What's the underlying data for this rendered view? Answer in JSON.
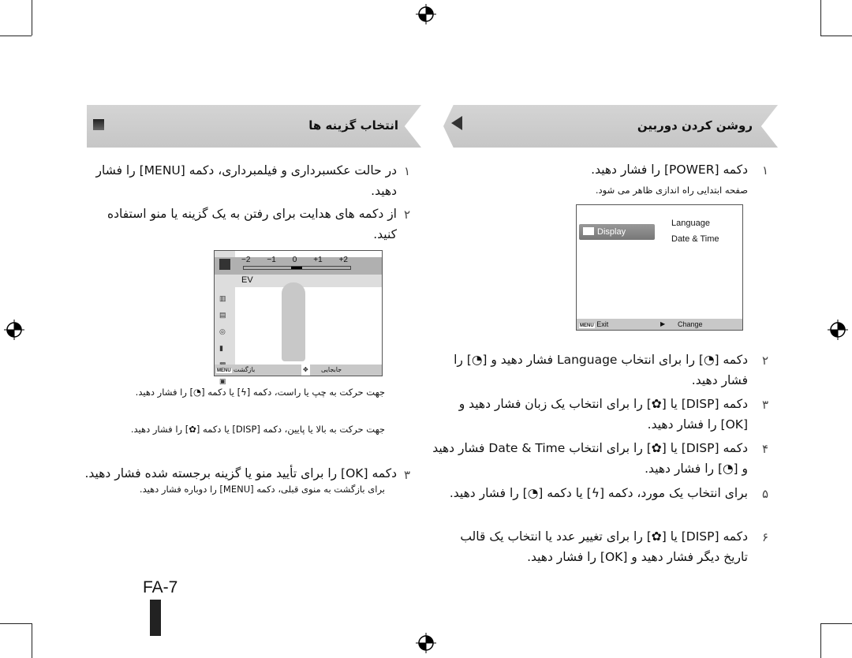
{
  "right": {
    "title": "روشن کردن دوربین",
    "steps": [
      {
        "num": "۱",
        "text": "دکمه [POWER] را فشار دهید.",
        "bullet": "صفحه ابتدایی راه اندازی ظاهر می شود."
      },
      {
        "num": "۲",
        "text": "دکمه [◔] را برای انتخاب Language فشار دهید و [◔] را فشار دهید."
      },
      {
        "num": "۳",
        "text": "دکمه [DISP] یا [✿] را برای انتخاب یک زبان فشار دهید و [OK] را فشار دهید."
      },
      {
        "num": "۴",
        "text": "دکمه [DISP] یا [✿] را برای انتخاب Date & Time فشار دهید و [◔] را فشار دهید."
      },
      {
        "num": "۵",
        "text": "برای انتخاب یک مورد، دکمه [ϟ] یا دکمه [◔] را فشار دهید."
      },
      {
        "num": "۶",
        "text": "دکمه [DISP] یا [✿] را برای تغییر عدد یا انتخاب یک قالب تاریخ دیگر فشار دهید و [OK] را فشار دهید."
      }
    ],
    "screen": {
      "menu_selected": "Display",
      "items": [
        "Language",
        "Date & Time"
      ],
      "exit_key": "MENU",
      "exit": "Exit",
      "change": "Change"
    }
  },
  "left": {
    "title": "انتخاب گزینه ها",
    "steps": [
      {
        "num": "۱",
        "text": "در حالت عکسبرداری و فیلمبرداری، دکمه [MENU] را فشار دهید."
      },
      {
        "num": "۲",
        "text": "از دکمه های هدایت برای رفتن به یک گزینه یا منو استفاده کنید.",
        "bullets": [
          "جهت حرکت به چپ یا راست، دکمه [ϟ] یا دکمه [◔] را فشار دهید.",
          "جهت حرکت به بالا یا پایین، دکمه [DISP] یا دکمه [✿] را فشار دهید."
        ]
      },
      {
        "num": "۳",
        "text": "دکمه [OK] را برای تأیید منو یا گزینه برجسته شده فشار دهید.",
        "bullet": "برای بازگشت به منوی قبلی، دکمه [MENU] را دوباره فشار دهید."
      }
    ],
    "screen": {
      "scale": [
        "−2",
        "−1",
        "0",
        "+1",
        "+2"
      ],
      "ev_value": 0,
      "selected": "EV",
      "back_key": "MENU",
      "back": "بازگشت",
      "move": "جابجایی"
    }
  },
  "page_number": "FA-7"
}
